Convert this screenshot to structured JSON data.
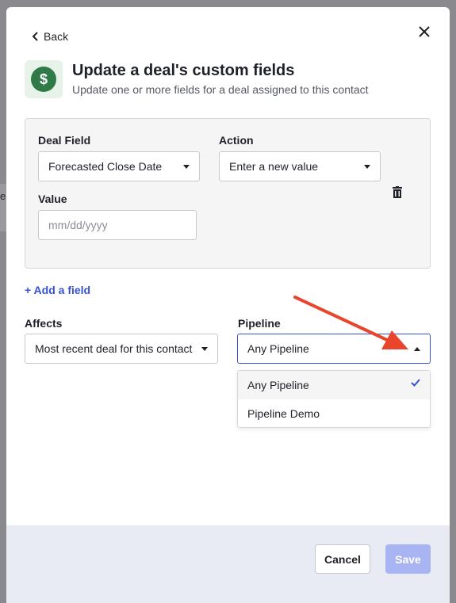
{
  "background": {
    "partial_letter": "e"
  },
  "modal": {
    "back_label": "Back",
    "title": "Update a deal's custom fields",
    "subtitle": "Update one or more fields for a deal assigned to this contact",
    "icon_symbol": "$",
    "icon": "dollar-circle-icon",
    "accent_color": "#3552d6",
    "icon_color": "#2f7a47"
  },
  "deal_field": {
    "label": "Deal Field",
    "value": "Forecasted Close Date"
  },
  "action": {
    "label": "Action",
    "value": "Enter a new value"
  },
  "value": {
    "label": "Value",
    "placeholder": "mm/dd/yyyy"
  },
  "add_field_label": "+ Add a field",
  "affects": {
    "label": "Affects",
    "value": "Most recent deal for this contact"
  },
  "pipeline": {
    "label": "Pipeline",
    "value": "Any Pipeline",
    "options": [
      {
        "label": "Any Pipeline",
        "selected": true
      },
      {
        "label": "Pipeline Demo",
        "selected": false
      }
    ]
  },
  "footer": {
    "cancel_label": "Cancel",
    "save_label": "Save",
    "save_color": "#a9b5f3"
  },
  "annotation": {
    "arrow_color": "#e8452c"
  }
}
